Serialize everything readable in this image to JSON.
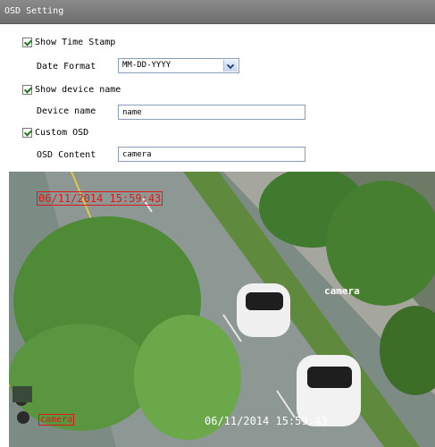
{
  "window": {
    "title": "OSD Setting"
  },
  "show_time_stamp": {
    "label": "Show Time Stamp",
    "checked": true
  },
  "date_format": {
    "label": "Date Format",
    "value": "MM-DD-YYYY"
  },
  "show_device_name": {
    "label": "Show device name",
    "checked": true
  },
  "device_name": {
    "label": "Device name",
    "value": "name"
  },
  "custom_osd": {
    "label": "Custom OSD",
    "checked": true
  },
  "osd_content": {
    "label": "OSD Content",
    "value": "camera"
  },
  "preview": {
    "timestamp_top": "06/11/2014 15:59:43",
    "timestamp_bottom": "06/11/2014 15:59:43",
    "device_name_overlay": "camera",
    "custom_overlay": "camera",
    "colors": {
      "red_osd": "#e01818",
      "white_osd": "#ffffff"
    }
  }
}
